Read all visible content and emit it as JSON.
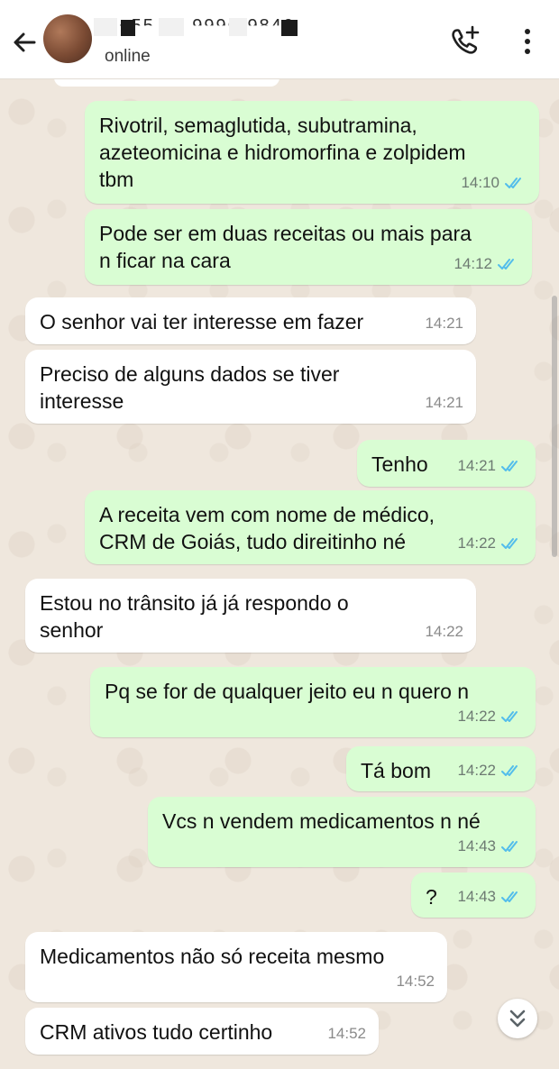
{
  "header": {
    "contact_name": "+55 62 9996-9846",
    "status": "online"
  },
  "colors": {
    "outgoing_bubble": "#d9fdd3",
    "incoming_bubble": "#ffffff",
    "chat_background": "#efe7dd",
    "read_ticks": "#53bdeb"
  },
  "icons": {
    "back": "arrow-left-icon",
    "call": "add-call-icon",
    "menu": "more-vert-icon",
    "read": "double-check-icon",
    "scroll_down": "chevron-double-down-icon"
  },
  "messages": [
    {
      "direction": "outgoing",
      "lines": [
        "Rivotril, semaglutida, subutramina,",
        "azeteomicina e hidromorfina e zolpidem",
        "tbm"
      ],
      "time": "14:10",
      "read": true
    },
    {
      "direction": "outgoing",
      "lines": [
        "Pode ser em duas receitas ou mais para",
        "n ficar na cara"
      ],
      "time": "14:12",
      "read": true
    },
    {
      "direction": "incoming",
      "lines": [
        "O senhor vai ter interesse em fazer"
      ],
      "time": "14:21"
    },
    {
      "direction": "incoming",
      "lines": [
        "Preciso de alguns dados se tiver",
        "interesse"
      ],
      "time": "14:21"
    },
    {
      "direction": "outgoing",
      "lines": [
        "Tenho"
      ],
      "time": "14:21",
      "read": true
    },
    {
      "direction": "outgoing",
      "lines": [
        "A receita vem com nome de médico,",
        "CRM de Goiás, tudo direitinho né"
      ],
      "time": "14:22",
      "read": true
    },
    {
      "direction": "incoming",
      "lines": [
        "Estou no trânsito já já respondo o",
        "senhor"
      ],
      "time": "14:22"
    },
    {
      "direction": "outgoing",
      "lines": [
        "Pq se for de qualquer jeito eu n quero  n"
      ],
      "time": "14:22",
      "read": true
    },
    {
      "direction": "outgoing",
      "lines": [
        "Tá bom"
      ],
      "time": "14:22",
      "read": true
    },
    {
      "direction": "outgoing",
      "lines": [
        "Vcs n vendem medicamentos n né"
      ],
      "time": "14:43",
      "read": true
    },
    {
      "direction": "outgoing",
      "lines": [
        "?"
      ],
      "time": "14:43",
      "read": true
    },
    {
      "direction": "incoming",
      "lines": [
        "Medicamentos não só receita mesmo"
      ],
      "time": "14:52"
    },
    {
      "direction": "incoming",
      "lines": [
        "CRM ativos tudo certinho"
      ],
      "time": "14:52"
    }
  ]
}
